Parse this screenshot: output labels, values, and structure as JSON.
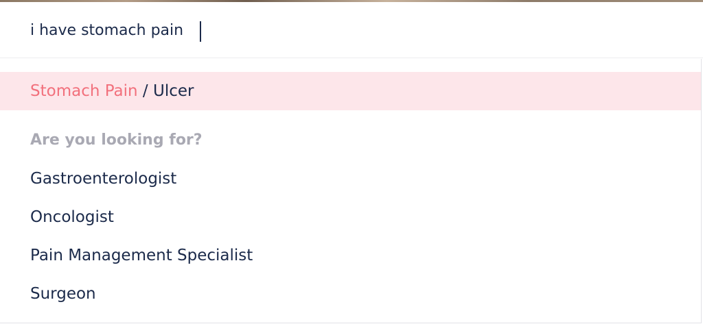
{
  "search": {
    "value": "i have stomach pain"
  },
  "suggestion": {
    "match": "Stomach Pain",
    "separator": " / ",
    "rest": "Ulcer"
  },
  "looking_for": {
    "heading": "Are you looking for?",
    "items": [
      {
        "label": "Gastroenterologist"
      },
      {
        "label": "Oncologist"
      },
      {
        "label": "Pain Management Specialist"
      },
      {
        "label": "Surgeon"
      }
    ]
  },
  "colors": {
    "highlight_bg": "#fde6ea",
    "match_text": "#f2707c",
    "primary_text": "#1b2a4a",
    "muted_text": "#a9a9b3"
  }
}
